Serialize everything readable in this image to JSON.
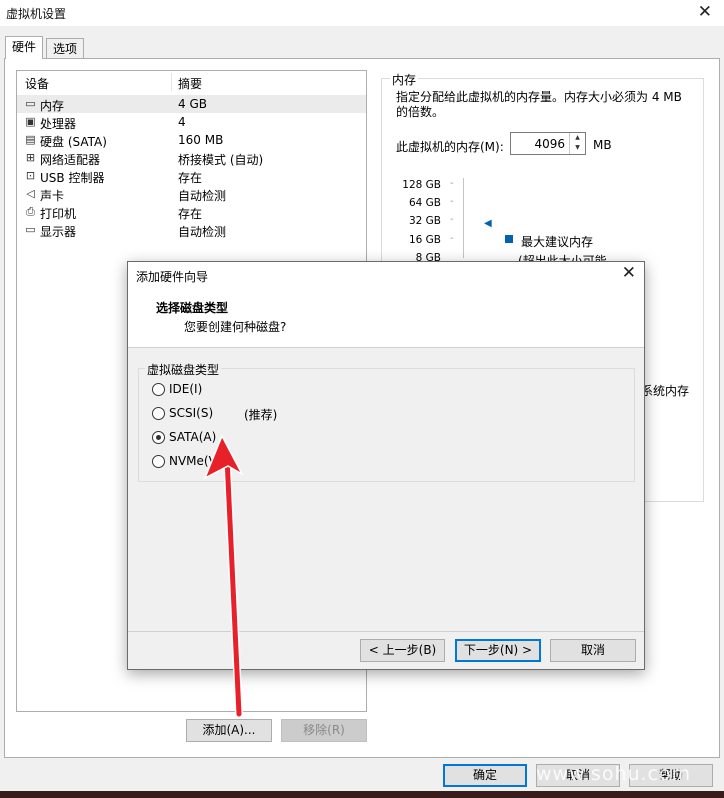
{
  "window": {
    "title": "虚拟机设置",
    "close_glyph": "✕"
  },
  "tabs": [
    {
      "label": "硬件"
    },
    {
      "label": "选项"
    }
  ],
  "device_list": {
    "col_device": "设备",
    "col_summary": "摘要",
    "rows": [
      {
        "icon": "memory-icon",
        "name": "内存",
        "summary": "4 GB"
      },
      {
        "icon": "cpu-icon",
        "name": "处理器",
        "summary": "4"
      },
      {
        "icon": "hard-disk-icon",
        "name": "硬盘 (SATA)",
        "summary": "160 MB"
      },
      {
        "icon": "network-adapter-icon",
        "name": "网络适配器",
        "summary": "桥接模式 (自动)"
      },
      {
        "icon": "usb-icon",
        "name": "USB 控制器",
        "summary": "存在"
      },
      {
        "icon": "sound-card-icon",
        "name": "声卡",
        "summary": "自动检测"
      },
      {
        "icon": "printer-icon",
        "name": "打印机",
        "summary": "存在"
      },
      {
        "icon": "display-icon",
        "name": "显示器",
        "summary": "自动检测"
      }
    ]
  },
  "memory_panel": {
    "group_label": "内存",
    "description": "指定分配给此虚拟机的内存量。内存大小必须为 4 MB 的倍数。",
    "field_label": "此虚拟机的内存(M):",
    "value": "4096",
    "unit": "MB",
    "scale_labels": [
      "128 GB",
      "64 GB",
      "32 GB",
      "16 GB",
      "8 GB"
    ],
    "legend_max": "最大建议内存",
    "legend_sub": "(超出此大小可能",
    "extra_text": "系统内存"
  },
  "buttons": {
    "add": "添加(A)...",
    "remove": "移除(R)",
    "ok": "确定",
    "cancel": "取消",
    "help": "帮助"
  },
  "dialog": {
    "title": "添加硬件向导",
    "close_glyph": "✕",
    "heading": "选择磁盘类型",
    "subheading": "您要创建何种磁盘?",
    "group_label": "虚拟磁盘类型",
    "options": [
      {
        "label": "IDE(I)",
        "selected": false
      },
      {
        "label": "SCSI(S)",
        "selected": false
      },
      {
        "label": "SATA(A)",
        "selected": true
      },
      {
        "label": "NVMe(V)",
        "selected": false
      }
    ],
    "recommended": "(推荐)",
    "buttons": {
      "back": "< 上一步(B)",
      "next": "下一步(N) >",
      "cancel": "取消"
    }
  },
  "watermark": "www.sohu.com",
  "colors": {
    "accent": "#0078d7",
    "arrow": "#e8202a",
    "selection": "#ebebeb"
  }
}
